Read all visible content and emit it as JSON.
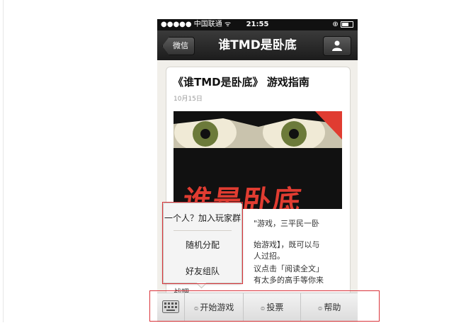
{
  "status_bar": {
    "carrier": "●●●●● 中国联通 ᯤ",
    "time": "21:55",
    "lock_icon": "⊕"
  },
  "nav": {
    "back_label": "微信",
    "title": "谁TMD是卧底",
    "profile_icon": "person-icon"
  },
  "article": {
    "title": "《谁TMD是卧底》 游戏指南",
    "date": "10月15日",
    "cover_text": "谁是卧底",
    "body_lines": [
      "\"游戏，三平民一卧",
      "始游戏】，既可以与",
      "人过招。",
      "议点击「阅读全文」",
      "有太多的高手等你来"
    ],
    "body_fragment": "战吧。"
  },
  "popup_menu": {
    "items": [
      "一个人？加入玩家群",
      "随机分配",
      "好友组队"
    ]
  },
  "bottom_menu": {
    "keyboard_icon": "keyboard-icon",
    "items": [
      "开始游戏",
      "投票",
      "帮助"
    ],
    "dot": "⊜"
  },
  "colors": {
    "highlight": "#d9333a",
    "navbar": "#1c1c1c",
    "cover_red": "#e03c31"
  }
}
